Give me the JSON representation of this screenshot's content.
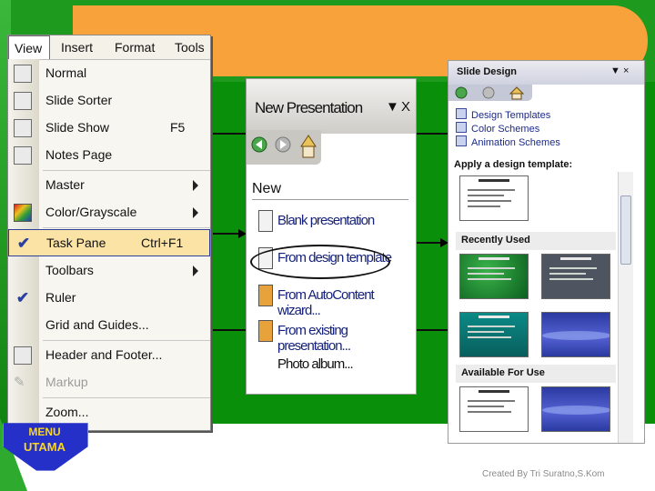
{
  "colors": {
    "green": "#0a8f0a",
    "orange": "#f8a23c",
    "highlight": "#fbe3a6",
    "menu_utama": "#2430c8"
  },
  "view_menu": {
    "menubar": {
      "view": "View",
      "insert": "Insert",
      "format": "Format",
      "tools": "Tools"
    },
    "items": [
      {
        "label": "Normal",
        "icon": "normal-view-icon"
      },
      {
        "label": "Slide Sorter",
        "icon": "slide-sorter-icon"
      },
      {
        "label": "Slide Show",
        "shortcut": "F5",
        "icon": "slide-show-icon"
      },
      {
        "label": "Notes Page",
        "icon": "notes-page-icon"
      },
      {
        "label": "Master",
        "submenu": true
      },
      {
        "label": "Color/Grayscale",
        "submenu": true,
        "icon": "color-grayscale-icon"
      },
      {
        "label": "Task Pane",
        "shortcut": "Ctrl+F1",
        "checked": true,
        "highlighted": true
      },
      {
        "label": "Toolbars",
        "submenu": true
      },
      {
        "label": "Ruler",
        "checked": true
      },
      {
        "label": "Grid and Guides..."
      },
      {
        "label": "Header and Footer...",
        "icon": "header-footer-icon"
      },
      {
        "label": "Markup",
        "disabled": true,
        "icon": "markup-icon"
      },
      {
        "label": "Zoom..."
      }
    ]
  },
  "new_presentation": {
    "title": "New Presentation",
    "controls": "▼ X",
    "section": "New",
    "items": [
      {
        "label": "Blank presentation"
      },
      {
        "label": "From design template"
      },
      {
        "label": "From AutoContent wizard..."
      },
      {
        "label": "From existing presentation..."
      },
      {
        "label": "Photo album..."
      }
    ]
  },
  "slide_design": {
    "title": "Slide Design",
    "controls": "▼ ×",
    "links": [
      "Design Templates",
      "Color Schemes",
      "Animation Schemes"
    ],
    "apply_label": "Apply a design template:",
    "recently_used": "Recently Used",
    "available": "Available For Use"
  },
  "menu_utama": {
    "line1": "MENU",
    "line2": "UTAMA"
  },
  "credit": "Created By Tri Suratno,S.Kom"
}
